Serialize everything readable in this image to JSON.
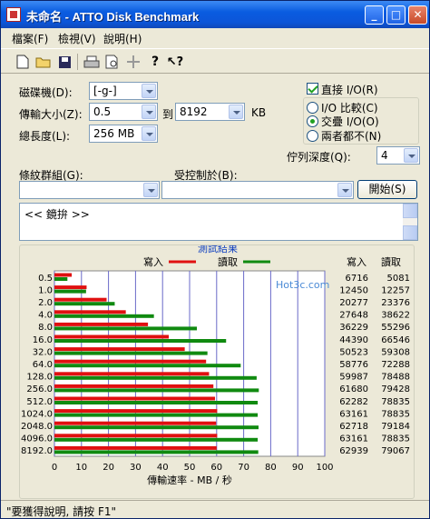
{
  "window": {
    "title": "未命名 - ATTO Disk Benchmark"
  },
  "menu": [
    "檔案(F)",
    "檢視(V)",
    "說明(H)"
  ],
  "toolbar_icons": [
    "new-file-icon",
    "open-folder-icon",
    "save-icon",
    "print-icon",
    "print-preview-icon",
    "move-icon",
    "help-icon",
    "context-help-icon"
  ],
  "form": {
    "drive_label": "磁碟機(D):",
    "drive_value": "[-g-]",
    "transfer_label": "傳輸大小(Z):",
    "transfer_from": "0.5",
    "to_label": "到",
    "transfer_to": "8192",
    "unit": "KB",
    "length_label": "總長度(L):",
    "length_value": "256 MB",
    "direct_io_label": "直接 I/O(R)",
    "direct_io_checked": true,
    "io_options": [
      "I/O 比較(C)",
      "交疊 I/O(O)",
      "兩者都不(N)"
    ],
    "io_selected": 1,
    "queue_label": "佇列深度(Q):",
    "queue_value": "4",
    "controlled_by_label": "受控制於(B):",
    "controlled_by_value": "",
    "group_label": "條紋群組(G):",
    "group_value": "",
    "start_label": "開始(S)",
    "log_text": "<< 鏡拚 >>"
  },
  "chart_data": {
    "type": "bar",
    "title": "測試結果",
    "legend": [
      "寫入",
      "讀取"
    ],
    "xlabel": "傳輸速率 - MB / 秒",
    "xlim": [
      0,
      100
    ],
    "xticks": [
      0,
      10,
      20,
      30,
      40,
      50,
      60,
      70,
      80,
      90,
      100
    ],
    "categories": [
      "0.5",
      "1.0",
      "2.0",
      "4.0",
      "8.0",
      "16.0",
      "32.0",
      "64.0",
      "128.0",
      "256.0",
      "512.0",
      "1024.0",
      "2048.0",
      "4096.0",
      "8192.0"
    ],
    "column_headers": [
      "寫入",
      "讀取"
    ],
    "series": [
      {
        "name": "寫入",
        "color": "#e01010",
        "values": [
          6.4,
          11.9,
          19.3,
          26.4,
          34.6,
          42.3,
          48.2,
          56.1,
          57.2,
          58.8,
          59.4,
          60.2,
          59.8,
          60.2,
          60.0
        ],
        "table": [
          6716,
          12450,
          20277,
          27648,
          36229,
          44390,
          50523,
          58776,
          59987,
          61680,
          62282,
          63161,
          62718,
          63161,
          62939
        ]
      },
      {
        "name": "讀取",
        "color": "#108a10",
        "values": [
          4.8,
          11.7,
          22.3,
          36.8,
          52.7,
          63.5,
          56.6,
          68.9,
          74.8,
          75.6,
          75.2,
          75.2,
          75.5,
          75.2,
          75.4
        ],
        "table": [
          5081,
          12257,
          23376,
          38622,
          55296,
          66546,
          59308,
          72288,
          78488,
          79428,
          78835,
          78835,
          79184,
          78835,
          79067
        ]
      }
    ],
    "watermark": "Hot3c.com"
  },
  "status": {
    "text": "\"要獲得說明, 請按 F1\""
  }
}
